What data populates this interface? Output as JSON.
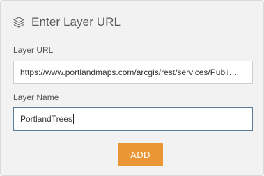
{
  "dialog": {
    "title": "Enter Layer URL",
    "icon": "layers-icon"
  },
  "layer_url": {
    "label": "Layer URL",
    "value": "https://www.portlandmaps.com/arcgis/rest/services/Publi…"
  },
  "layer_name": {
    "label": "Layer Name",
    "value": "PortlandTrees"
  },
  "actions": {
    "add_label": "ADD"
  },
  "colors": {
    "panel_bg": "#f2f2f2",
    "accent": "#ea9635",
    "focus_border": "#5b7c99"
  }
}
